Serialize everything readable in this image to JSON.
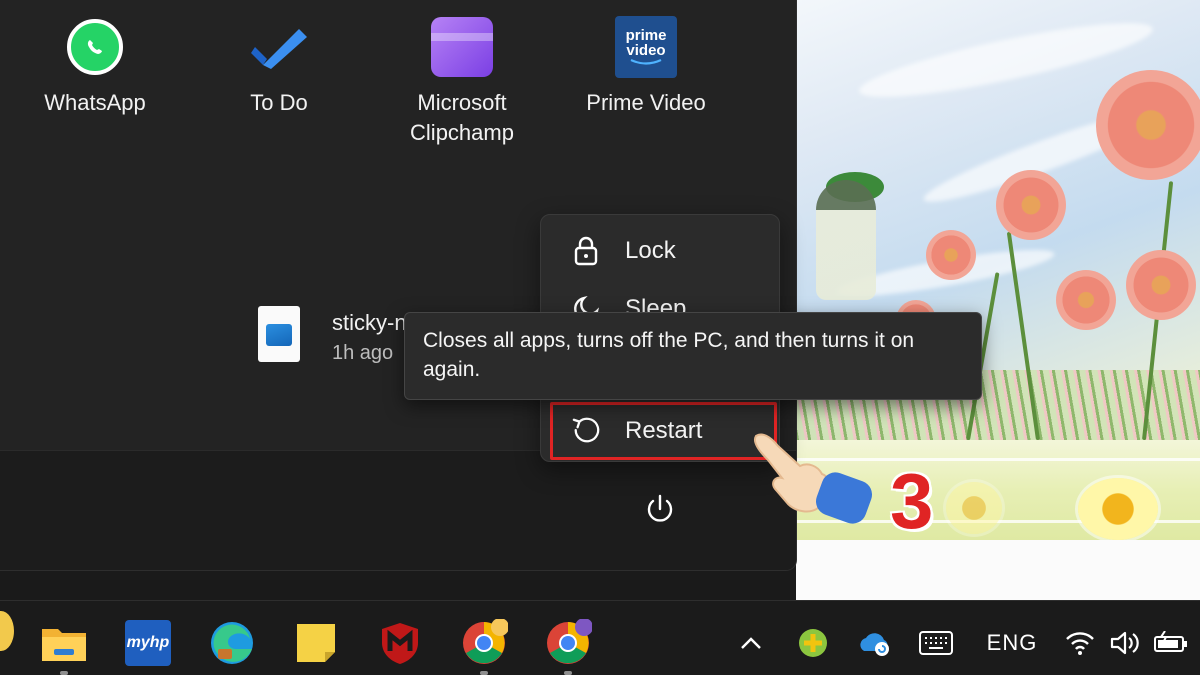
{
  "pinned_apps": [
    {
      "label": "WhatsApp",
      "icon": "whatsapp-icon"
    },
    {
      "label": "To Do",
      "icon": "todo-icon"
    },
    {
      "label": "Microsoft\nClipchamp",
      "icon": "clipchamp-icon"
    },
    {
      "label": "Prime Video",
      "icon": "prime-video-icon",
      "icon_text_1": "prime",
      "icon_text_2": "video"
    }
  ],
  "recommended": {
    "file_name": "sticky-n",
    "time": "1h ago",
    "icon": "image-file-icon"
  },
  "power_menu": {
    "items": [
      {
        "label": "Lock",
        "icon": "lock-icon"
      },
      {
        "label": "Sleep",
        "icon": "moon-icon"
      },
      {
        "label": "Restart",
        "icon": "restart-icon"
      }
    ],
    "tooltip": "Closes all apps, turns off the PC, and then turns it on again.",
    "power_button_icon": "power-icon"
  },
  "annotation": {
    "step": "3",
    "color": "#e02424"
  },
  "taskbar": {
    "apps": [
      {
        "name": "file-explorer-icon"
      },
      {
        "name": "myhp-icon",
        "text": "myhp"
      },
      {
        "name": "edge-icon"
      },
      {
        "name": "sticky-notes-icon"
      },
      {
        "name": "mcafee-icon"
      },
      {
        "name": "chrome-icon"
      },
      {
        "name": "chrome-profile-icon"
      }
    ],
    "tray": {
      "language": "ENG",
      "icons": [
        "chevron-up-icon",
        "greenshot-icon",
        "onedrive-icon",
        "keyboard-icon",
        "wifi-icon",
        "speaker-icon",
        "battery-icon"
      ]
    }
  },
  "colors": {
    "start_bg": "#202020",
    "flyout_bg": "#2b2b2b",
    "highlight": "#e02424",
    "taskbar_bg": "#1b1b1b"
  }
}
